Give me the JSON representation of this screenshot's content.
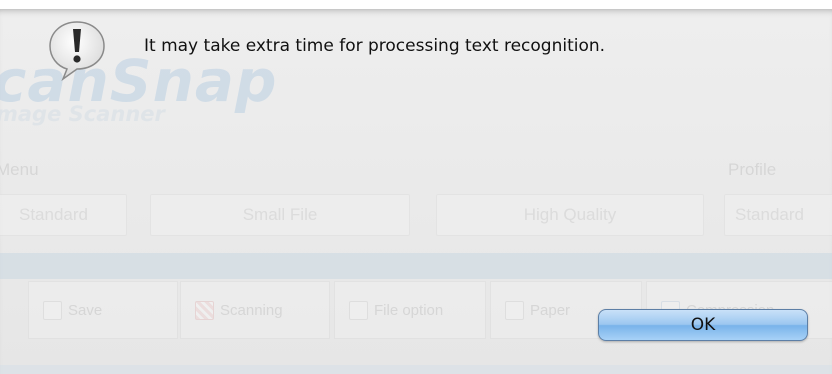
{
  "alert": {
    "message": "It may take extra time for processing text recognition.",
    "ok_label": "OK",
    "icon": "warning-exclamation-bubble-icon"
  },
  "background": {
    "logo_text": "canSnap",
    "logo_subtitle": "mage Scanner",
    "menu_label": "Menu",
    "profile_label": "Profile",
    "modes": [
      "Standard",
      "Small File",
      "High Quality"
    ],
    "profile_value": "Standard",
    "tabs": [
      "Save",
      "Scanning",
      "File option",
      "Paper",
      "Compression"
    ]
  },
  "colors": {
    "ok_button": "#8cc0f0",
    "logo": "#b6cde2",
    "band": "#c7d7e2"
  }
}
